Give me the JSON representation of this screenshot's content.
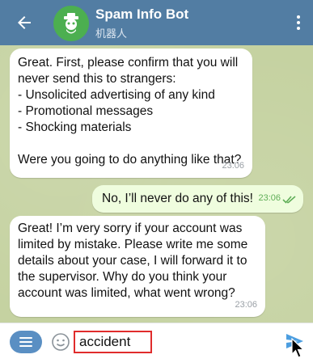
{
  "header": {
    "title": "Spam Info Bot",
    "subtitle": "机器人"
  },
  "messages": [
    {
      "direction": "incoming",
      "text": "Great. First, please confirm that you will never send this to strangers:\n- Unsolicited advertising of any kind\n- Promotional messages\n- Shocking materials\n\nWere you going to do anything like that?",
      "time": "23:06"
    },
    {
      "direction": "outgoing",
      "text": "No, I’ll never do any of this!",
      "time": "23:06"
    },
    {
      "direction": "incoming",
      "text": "Great! I’m very sorry if your account was limited by mistake. Please write me some details about your case, I will forward it to the supervisor. Why do you think your account was limited, what went wrong?",
      "time": "23:06"
    }
  ],
  "composer": {
    "value": "accident"
  },
  "icons": {
    "back": "back-arrow-icon",
    "avatar": "bot-avatar-icon",
    "menu": "more-vertical-icon",
    "bot_menu": "bot-menu-icon",
    "emoji": "emoji-icon",
    "send": "send-icon",
    "read": "double-check-icon"
  },
  "colors": {
    "header": "#527da3",
    "avatar": "#4caf50",
    "outgoing_bubble": "#effdde",
    "highlight": "#e02c2c"
  }
}
